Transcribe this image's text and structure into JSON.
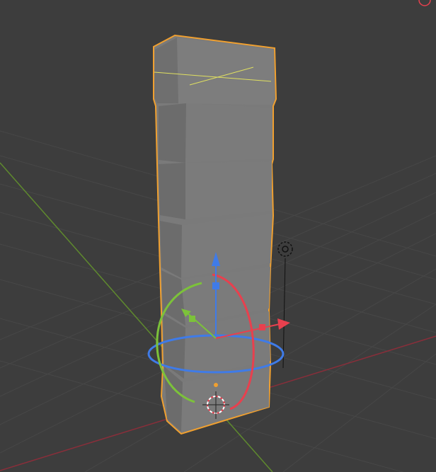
{
  "viewport": {
    "background_color": "#3d3d3d",
    "grid_color": "#474747",
    "selection_outline_color": "#f0a030",
    "stack_face_color": "#7a7a7a",
    "stack_side_color": "#6e6e6e",
    "stack_seam_color": "#4a4a4a",
    "x_axis_color": "#8a2e3a",
    "y_axis_color": "#5f8a2e",
    "gizmo": {
      "x_color": "#e8404e",
      "y_color": "#7cc23a",
      "z_color": "#3f7be8",
      "rotation_ring_x_color": "#e8404e",
      "rotation_ring_y_color": "#7cc23a",
      "rotation_ring_z_color": "#3f7be8"
    },
    "light_icon": "light-bulb-icon",
    "cursor_icon": "3d-cursor-icon",
    "object": {
      "type": "stacked-block-mesh",
      "block_count": 6,
      "selected": true
    }
  }
}
